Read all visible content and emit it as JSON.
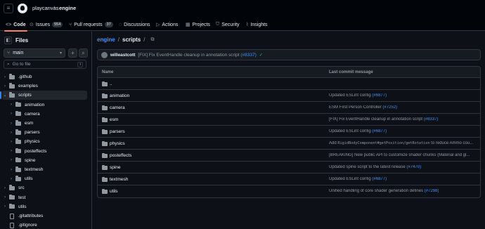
{
  "header": {
    "owner": "playcanvas",
    "separator": "/",
    "repo": "engine"
  },
  "tabs": [
    {
      "label": "Code",
      "icon": "code-icon",
      "count": null
    },
    {
      "label": "Issues",
      "icon": "issue-icon",
      "count": "554"
    },
    {
      "label": "Pull requests",
      "icon": "pull-request-icon",
      "count": "37"
    },
    {
      "label": "Discussions",
      "icon": "discussion-icon",
      "count": null
    },
    {
      "label": "Actions",
      "icon": "play-icon",
      "count": null
    },
    {
      "label": "Projects",
      "icon": "table-icon",
      "count": null
    },
    {
      "label": "Security",
      "icon": "shield-icon",
      "count": null
    },
    {
      "label": "Insights",
      "icon": "graph-icon",
      "count": null
    }
  ],
  "sidebar": {
    "title": "Files",
    "branch": "main",
    "goto_placeholder": "Go to file",
    "goto_shortcut": "t",
    "tree": [
      {
        "label": ".github",
        "type": "folder",
        "expanded": false,
        "depth": 0
      },
      {
        "label": "examples",
        "type": "folder",
        "expanded": false,
        "depth": 0
      },
      {
        "label": "scripts",
        "type": "folder",
        "expanded": true,
        "depth": 0,
        "selected": true
      },
      {
        "label": "animation",
        "type": "folder",
        "expanded": false,
        "depth": 1
      },
      {
        "label": "camera",
        "type": "folder",
        "expanded": false,
        "depth": 1
      },
      {
        "label": "esm",
        "type": "folder",
        "expanded": false,
        "depth": 1
      },
      {
        "label": "parsers",
        "type": "folder",
        "expanded": false,
        "depth": 1
      },
      {
        "label": "physics",
        "type": "folder",
        "expanded": false,
        "depth": 1
      },
      {
        "label": "posteffects",
        "type": "folder",
        "expanded": false,
        "depth": 1
      },
      {
        "label": "spine",
        "type": "folder",
        "expanded": false,
        "depth": 1
      },
      {
        "label": "textmesh",
        "type": "folder",
        "expanded": false,
        "depth": 1
      },
      {
        "label": "utils",
        "type": "folder",
        "expanded": false,
        "depth": 1
      },
      {
        "label": "src",
        "type": "folder",
        "expanded": false,
        "depth": 0
      },
      {
        "label": "test",
        "type": "folder",
        "expanded": false,
        "depth": 0
      },
      {
        "label": "utils",
        "type": "folder",
        "expanded": false,
        "depth": 0
      },
      {
        "label": ".gitattributes",
        "type": "file",
        "depth": 0
      },
      {
        "label": ".gitignore",
        "type": "file",
        "depth": 0
      }
    ]
  },
  "breadcrumb": {
    "repo": "engine",
    "folder": "scripts",
    "sep": "/"
  },
  "latest_commit": {
    "author": "willeastcott",
    "message": "[FIX] Fix EventHandle cleanup in annotation script",
    "pr": "(#8337)"
  },
  "table": {
    "col_name": "Name",
    "col_commit": "Last commit message",
    "parent": "..",
    "rows": [
      {
        "name": "animation",
        "msg": "Updated ESLint config",
        "code": "",
        "msg2": "",
        "pr": "(#6877)"
      },
      {
        "name": "camera",
        "msg": "ESM First Person Controller",
        "code": "",
        "msg2": "",
        "pr": "(#7252)"
      },
      {
        "name": "esm",
        "msg": "[FIX] Fix EventHandle cleanup in annotation script",
        "code": "",
        "msg2": "",
        "pr": "(#8337)"
      },
      {
        "name": "parsers",
        "msg": "Updated ESLint config",
        "code": "",
        "msg2": "",
        "pr": "(#6877)"
      },
      {
        "name": "physics",
        "msg": "Add ",
        "code": "RigidBodyComponent#getPosition/getRotation",
        "msg2": " to reduce Ammo cou...",
        "pr": ""
      },
      {
        "name": "posteffects",
        "msg": "[BREAKING] New public API to customize shader chunks (Material and gl...",
        "code": "",
        "msg2": "",
        "pr": ""
      },
      {
        "name": "spine",
        "msg": "Updated spine script to the latest release",
        "code": "",
        "msg2": "",
        "pr": "(#7470)"
      },
      {
        "name": "textmesh",
        "msg": "Updated ESLint config",
        "code": "",
        "msg2": "",
        "pr": "(#6877)"
      },
      {
        "name": "utils",
        "msg": "Unified handling of core shader generation defines",
        "code": "",
        "msg2": "",
        "pr": "(#7298)"
      }
    ]
  }
}
